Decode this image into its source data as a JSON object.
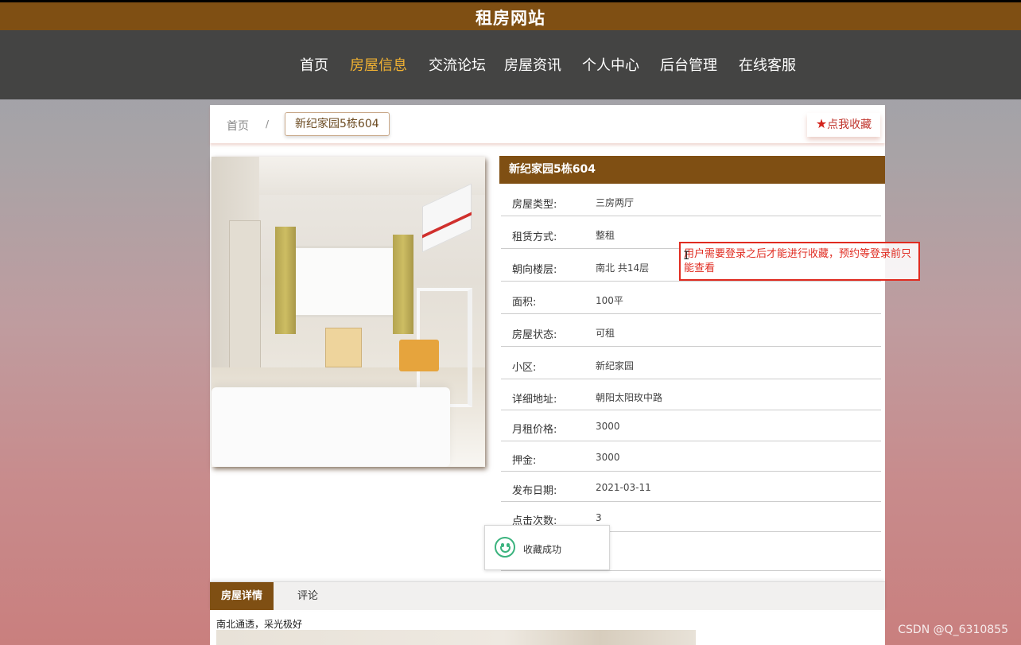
{
  "site": {
    "title": "租房网站"
  },
  "nav": {
    "items": [
      {
        "label": "首页"
      },
      {
        "label": "房屋信息"
      },
      {
        "label": "交流论坛"
      },
      {
        "label": "房屋资讯"
      },
      {
        "label": "个人中心"
      },
      {
        "label": "后台管理"
      },
      {
        "label": "在线客服"
      }
    ],
    "active_index": 1
  },
  "breadcrumb": {
    "home": "首页",
    "separator": "/",
    "current": "新纪家园5栋604"
  },
  "favorite_button": {
    "icon": "star-icon",
    "label": "点我收藏"
  },
  "house": {
    "title": "新纪家园5栋604",
    "fields": [
      {
        "label": "房屋类型:",
        "value": "三房两厅"
      },
      {
        "label": "租赁方式:",
        "value": "整租"
      },
      {
        "label": "朝向楼层:",
        "value": "南北 共14层"
      },
      {
        "label": "面积:",
        "value": "100平"
      },
      {
        "label": "房屋状态:",
        "value": "可租"
      },
      {
        "label": "小区:",
        "value": "新纪家园"
      },
      {
        "label": "详细地址:",
        "value": "朝阳太阳玫中路"
      },
      {
        "label": "月租价格:",
        "value": "3000"
      },
      {
        "label": "押金:",
        "value": "3000"
      },
      {
        "label": "发布日期:",
        "value": "2021-03-11"
      },
      {
        "label": "点击次数:",
        "value": "3"
      }
    ]
  },
  "toast": {
    "icon": "smile-icon",
    "message": "收藏成功"
  },
  "tabs": [
    {
      "label": "房屋详情"
    },
    {
      "label": "评论"
    }
  ],
  "detail": {
    "text": "南北通透，采光极好"
  },
  "annotation": {
    "text": "用户需要登录之后才能进行收藏，预约等登录前只能查看"
  },
  "watermark": "CSDN @Q_6310855",
  "colors": {
    "brand": "#7f4f13",
    "nav_bg": "#444443",
    "nav_active": "#f0b132",
    "annotation": "#e02b20"
  }
}
